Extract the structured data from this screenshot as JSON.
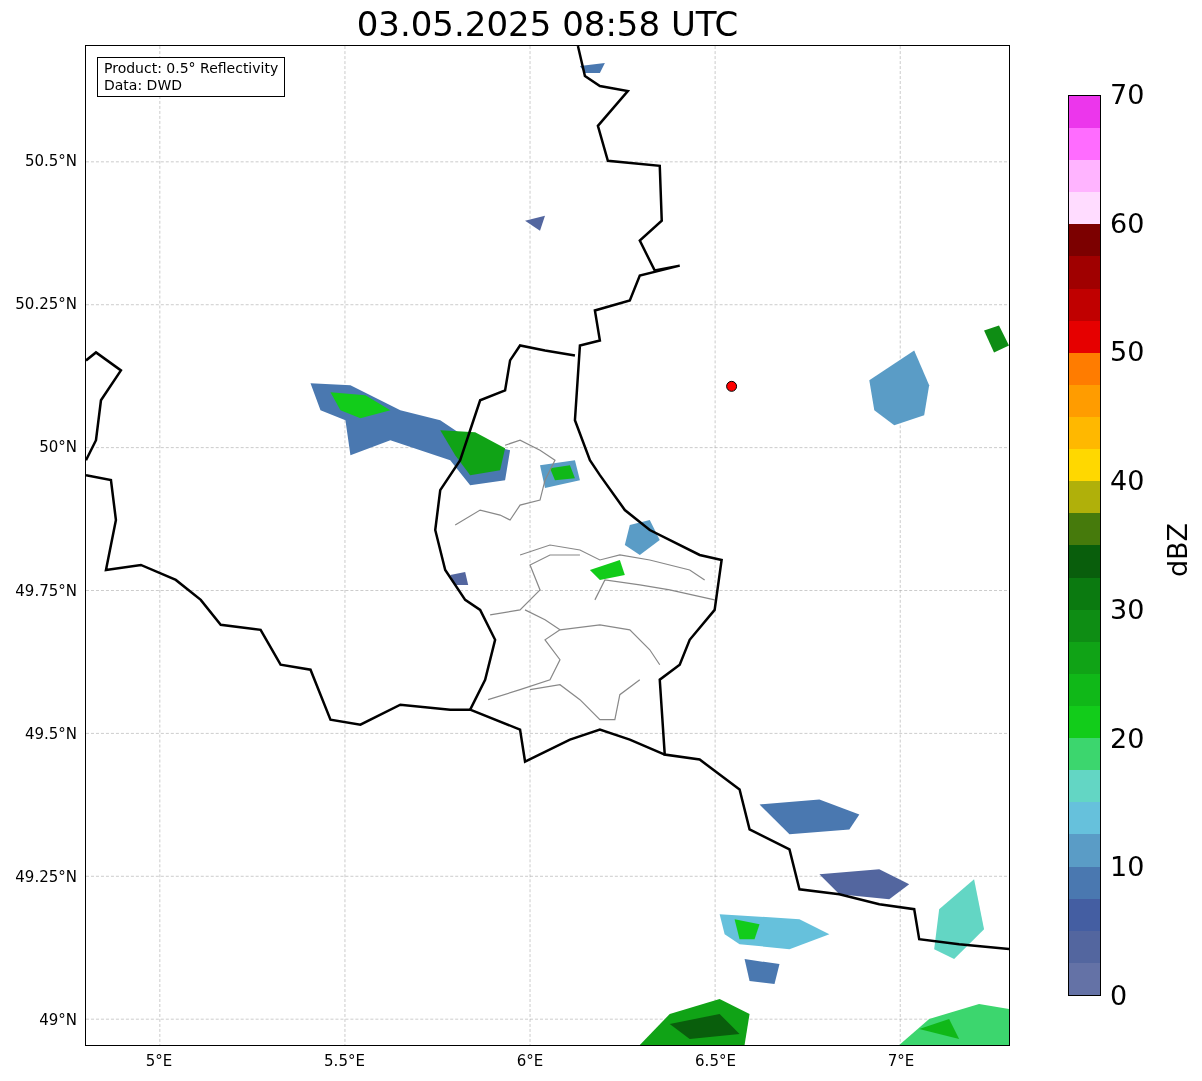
{
  "title": "03.05.2025 08:58 UTC",
  "legend": [
    "Product: 0.5° Reflectivity",
    "Data: DWD"
  ],
  "y_ticks": [
    "50.5°N",
    "50.25°N",
    "50°N",
    "49.75°N",
    "49.5°N",
    "49.25°N",
    "49°N"
  ],
  "x_ticks": [
    "5°E",
    "5.5°E",
    "6°E",
    "6.5°E",
    "7°E"
  ],
  "colorbar": {
    "label": "dBZ",
    "ticks": [
      "70",
      "60",
      "50",
      "40",
      "30",
      "20",
      "10",
      "0"
    ],
    "bands": [
      {
        "color": "#6472a6"
      },
      {
        "color": "#53669f"
      },
      {
        "color": "#445ea2"
      },
      {
        "color": "#4a78b0"
      },
      {
        "color": "#5a9cc6"
      },
      {
        "color": "#66c1dc"
      },
      {
        "color": "#63d6c4"
      },
      {
        "color": "#3cd66e"
      },
      {
        "color": "#12cc1a"
      },
      {
        "color": "#10b818"
      },
      {
        "color": "#10a316"
      },
      {
        "color": "#0e8d14"
      },
      {
        "color": "#0b7a10"
      },
      {
        "color": "#095e0c"
      },
      {
        "color": "#467a0c"
      },
      {
        "color": "#b0b00a"
      },
      {
        "color": "#ffd800"
      },
      {
        "color": "#ffb800"
      },
      {
        "color": "#ff9c00"
      },
      {
        "color": "#ff7c00"
      },
      {
        "color": "#e60000"
      },
      {
        "color": "#c00000"
      },
      {
        "color": "#a00000"
      },
      {
        "color": "#7c0000"
      },
      {
        "color": "#ffdcff"
      },
      {
        "color": "#ffb4ff"
      },
      {
        "color": "#ff6cff"
      },
      {
        "color": "#ec36ec"
      }
    ]
  }
}
